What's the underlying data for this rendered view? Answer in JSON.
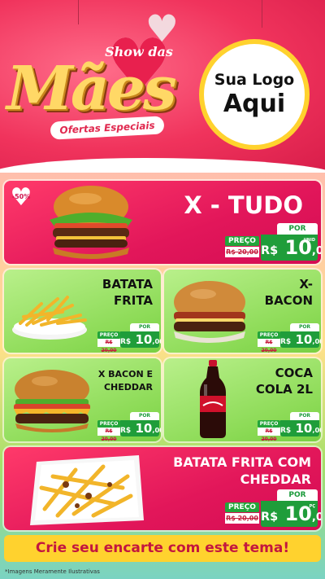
{
  "header": {
    "brand_top": "Show das",
    "brand_main": "Mães",
    "brand_tag": "Ofertas Especiais",
    "logo_line1": "Sua Logo",
    "logo_line2": "Aqui"
  },
  "discount_badge": "-50%",
  "products": [
    {
      "name": "X - TUDO",
      "label_preco": "PREÇO",
      "label_por": "POR",
      "old_price": "R$ 20,00",
      "currency": "R$",
      "price_int": "10",
      "price_dec": ",00",
      "unit": "UNID",
      "icon": "burger-icon"
    },
    {
      "name_l1": "BATATA",
      "name_l2": "FRITA",
      "label_preco": "PREÇO",
      "label_por": "POR",
      "old_price": "R$ 20,00",
      "currency": "R$",
      "price_int": "10",
      "price_dec": ",00",
      "unit": "PÇ",
      "icon": "fries-icon"
    },
    {
      "name_l1": "X-",
      "name_l2": "BACON",
      "label_preco": "PREÇO",
      "label_por": "POR",
      "old_price": "R$ 20,00",
      "currency": "R$",
      "price_int": "10",
      "price_dec": ",00",
      "unit": "PÇ",
      "icon": "bacon-burger-icon"
    },
    {
      "name_l1": "X BACON E",
      "name_l2": "CHEDDAR",
      "label_preco": "PREÇO",
      "label_por": "POR",
      "old_price": "R$ 20,00",
      "currency": "R$",
      "price_int": "10",
      "price_dec": ",00",
      "unit": "PÇ",
      "icon": "cheddar-burger-icon"
    },
    {
      "name_l1": "COCA",
      "name_l2": "COLA 2L",
      "label_preco": "PREÇO",
      "label_por": "POR",
      "old_price": "R$ 20,00",
      "currency": "R$",
      "price_int": "10",
      "price_dec": ",00",
      "unit": "PÇ",
      "icon": "soda-bottle-icon"
    },
    {
      "name_l1": "BATATA FRITA COM",
      "name_l2": "CHEDDAR",
      "label_preco": "PREÇO",
      "label_por": "POR",
      "old_price": "R$ 20,00",
      "currency": "R$",
      "price_int": "10",
      "price_dec": ",00",
      "unit": "PÇ",
      "icon": "cheddar-fries-icon"
    }
  ],
  "footer": {
    "cta": "Crie seu encarte com este tema!",
    "disclaimer": "*Imagens Meramente Ilustrativas"
  },
  "colors": {
    "pink": "#e2165a",
    "green": "#8ddb57",
    "yellow": "#ffd22e",
    "price_green": "#1f9d3a"
  }
}
